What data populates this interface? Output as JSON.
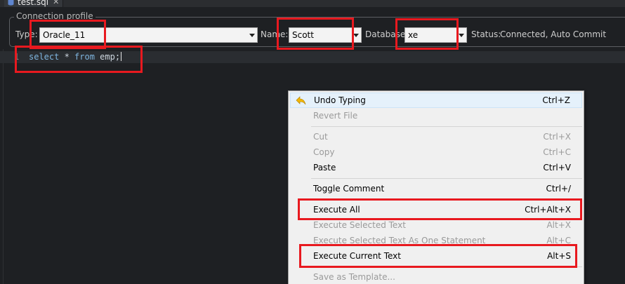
{
  "tab": {
    "title": "test.sql",
    "close_glyph": "✕"
  },
  "connection_profile": {
    "legend": "Connection profile",
    "type_label": "Type:",
    "type_value": "Oracle_11",
    "name_label": "Name:",
    "name_value": "Scott",
    "database_label": "Database:",
    "database_value": "xe",
    "status_label": "Status:",
    "status_value": "Connected, Auto Commit"
  },
  "editor": {
    "line_number": "1",
    "code": {
      "kw1": "select",
      "mid": " * ",
      "kw2": "from",
      "rest": " emp;"
    }
  },
  "context_menu": {
    "items": [
      {
        "label": "Undo Typing",
        "shortcut": "Ctrl+Z"
      },
      {
        "label": "Revert File",
        "shortcut": ""
      },
      {
        "label": "Cut",
        "shortcut": "Ctrl+X"
      },
      {
        "label": "Copy",
        "shortcut": "Ctrl+C"
      },
      {
        "label": "Paste",
        "shortcut": "Ctrl+V"
      },
      {
        "label": "Toggle Comment",
        "shortcut": "Ctrl+/"
      },
      {
        "label": "Execute All",
        "shortcut": "Ctrl+Alt+X"
      },
      {
        "label": "Execute Selected Text",
        "shortcut": "Alt+X"
      },
      {
        "label": "Execute Selected Text As One Statement",
        "shortcut": "Alt+C"
      },
      {
        "label": "Execute Current Text",
        "shortcut": "Alt+S"
      },
      {
        "label": "Save as Template...",
        "shortcut": ""
      }
    ]
  },
  "colors": {
    "annotation": "#e8191f",
    "editor_bg": "#1e2023",
    "menu_bg": "#f0f0f0",
    "keyword": "#7fb6e0"
  }
}
